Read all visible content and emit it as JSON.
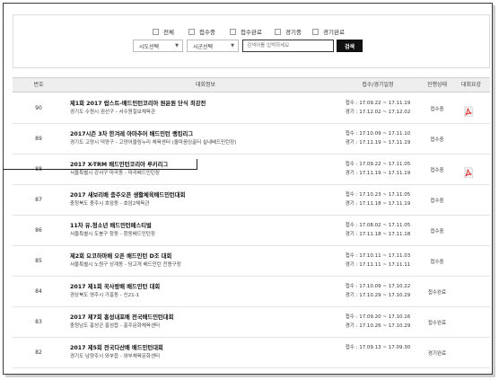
{
  "filter": {
    "checkboxes": [
      {
        "label": "전체"
      },
      {
        "label": "접수중"
      },
      {
        "label": "접수완료"
      },
      {
        "label": "경기중"
      },
      {
        "label": "경기완료"
      }
    ],
    "province_select": "시도선택",
    "city_select": "시군선택",
    "search_placeholder": "검색어를 입력하세요",
    "search_button": "검색"
  },
  "table": {
    "headers": {
      "num": "번호",
      "info": "대회정보",
      "dates": "접수/경기일정",
      "status": "진행상태",
      "outline": "대회요강"
    },
    "rows": [
      {
        "num": "90",
        "title": "제1회 2017 랍스트-배드민턴코리아 원윤원 단식 최강전",
        "place": "경기도 수원시 권선구 - 서수원칠보체육관",
        "receipt": "접수 : 17.09.22 ~ 17.11.19",
        "game": "경기 : 17.12.02 ~ 17.12.02",
        "status": "접수중",
        "pdf": true
      },
      {
        "num": "89",
        "title": "2017시즌 3차 한겨레 아마추어 배드민턴 랭킹리그",
        "place": "경기도 고양시 덕양구 - 고양어울림누리 체육센터 (올마음잉골터 실내배드민턴장)",
        "receipt": "접수 : 17.10.09 ~ 17.11.10",
        "game": "경기 : 17.11.19 ~ 17.11.19",
        "status": "접수중",
        "pdf": false
      },
      {
        "num": "88",
        "title": "2017 X-TRM 배드민턴코리아 루키리그",
        "place": "서울특별시 강서구 마곡동 - 마곡배드민턴장",
        "receipt": "접수 : 17.09.22 ~ 17.11.05",
        "game": "경기 : 17.11.19 ~ 17.11.19",
        "status": "접수중",
        "pdf": true
      },
      {
        "num": "87",
        "title": "2017 새보리배 충주오픈 생활체육배드민턴대회",
        "place": "충청북도 충주시 호암동 - 호암2체육관",
        "receipt": "접수 : 17.10.23 ~ 17.11.05",
        "game": "경기 : 17.11.18 ~ 17.11.19",
        "status": "접수중",
        "pdf": false
      },
      {
        "num": "86",
        "title": "11차 유.청소년 배드민턴페스티벌",
        "place": "서울특별시 도봉구 창동 - 창동배드민턴장",
        "receipt": "접수 : 17.08.02 ~ 17.11.05",
        "game": "경기 : 17.11.18 ~ 17.11.18",
        "status": "접수중",
        "pdf": false
      },
      {
        "num": "85",
        "title": "제2회 요코하마배 오픈 배드민턴 D조 대회",
        "place": "서울특별시 노원구 상계동 - 당고개 배드민턴 전용구장",
        "receipt": "접수 : 17.10.11 ~ 17.11.03",
        "game": "경기 : 17.11.11 ~ 17.11.11",
        "status": "접수중",
        "pdf": false
      },
      {
        "num": "84",
        "title": "2017 제1회 꾹사랑배 배드민턴 대회",
        "place": "경상북도 영주시 가흥동 - 신21-1",
        "receipt": "접수 : 17.10.09 ~ 17.10.22",
        "game": "경기 : 17.10.29 ~ 17.10.29",
        "status": "접수완료",
        "pdf": false
      },
      {
        "num": "83",
        "title": "2017 제7회 홍성내포배 전국배드민턴대회",
        "place": "충청남도 홍성군 홍성읍 - 홍주문화체육센터",
        "receipt": "접수 : 17.09.20 ~ 17.10.16",
        "game": "경기 : 17.10.26 ~ 17.10.29",
        "status": "접수완료",
        "pdf": false
      },
      {
        "num": "82",
        "title": "2017 제5회 전국다산배 배드민턴대회",
        "place": "경기도 남양주시 와부읍 - 와부체육문화센터",
        "receipt": "접수 : 17.09.13 ~ 17.09.30",
        "game": "",
        "status": "경기완료",
        "pdf": false
      }
    ]
  }
}
